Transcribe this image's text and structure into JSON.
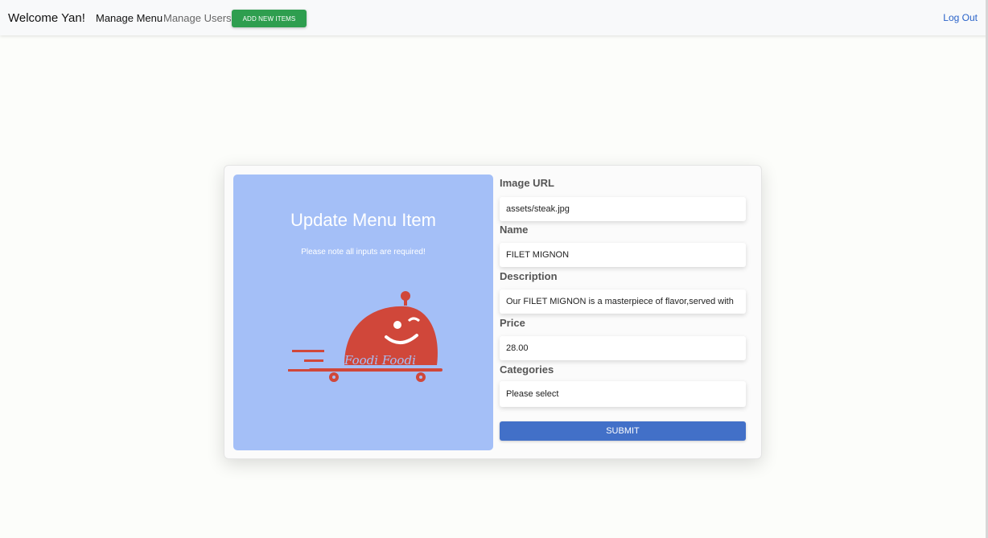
{
  "navbar": {
    "brand": "Welcome Yan!",
    "links": [
      "Manage Menu",
      "Manage Users"
    ],
    "add_button": "ADD NEW ITEMS",
    "logout": "Log Out"
  },
  "panel": {
    "title": "Update Menu Item",
    "note": "Please note all inputs are required!",
    "logo_text": "Foodi Foodi"
  },
  "form": {
    "image_url": {
      "label": "Image URL",
      "value": "assets/steak.jpg"
    },
    "name": {
      "label": "Name",
      "value": "FILET MIGNON"
    },
    "description": {
      "label": "Description",
      "value": "Our FILET MIGNON is a masterpiece of flavor,served with"
    },
    "price": {
      "label": "Price",
      "value": "28.00"
    },
    "categories": {
      "label": "Categories",
      "selected": "Please select"
    },
    "submit": "SUBMIT"
  },
  "colors": {
    "add_button": "#2e9e4f",
    "panel_bg": "#a4bff7",
    "submit": "#4270c8",
    "logo_red": "#d0473a"
  },
  "icons": [
    "foodi-logo-icon"
  ]
}
